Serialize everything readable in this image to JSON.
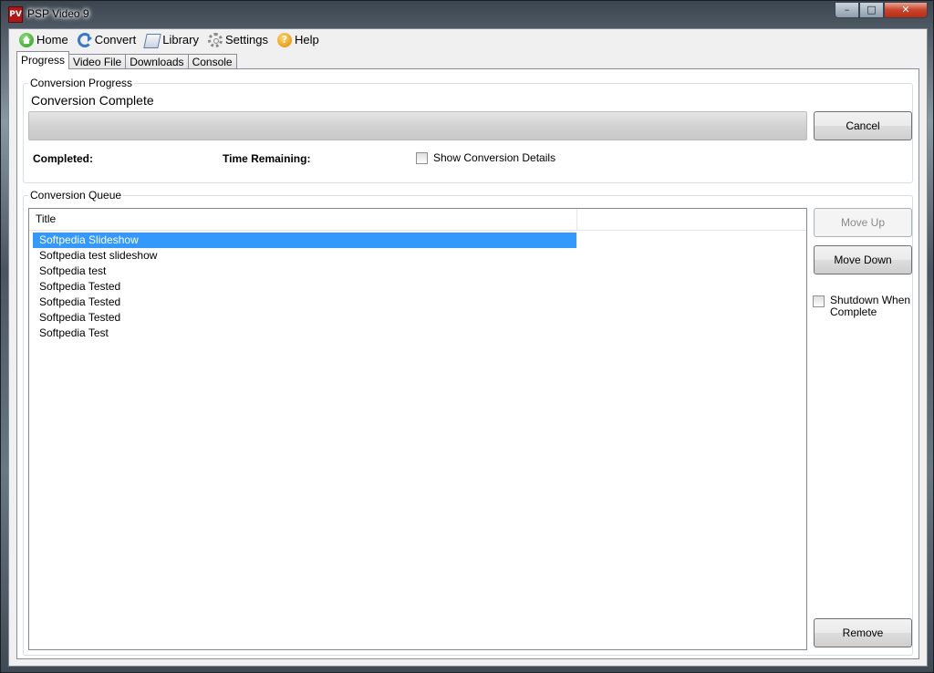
{
  "window": {
    "title": "PSP Video 9",
    "icon": "app-icon",
    "app_icon_glyph": "PV",
    "buttons": {
      "minimize": "–",
      "maximize": "□",
      "close": "✕"
    }
  },
  "menu": [
    {
      "label": "Home",
      "icon": "home-icon"
    },
    {
      "label": "Convert",
      "icon": "convert-icon"
    },
    {
      "label": "Library",
      "icon": "library-icon"
    },
    {
      "label": "Settings",
      "icon": "settings-icon"
    },
    {
      "label": "Help",
      "icon": "help-icon",
      "glyph": "?"
    }
  ],
  "tabs": [
    {
      "label": "Progress",
      "active": true
    },
    {
      "label": "Video File"
    },
    {
      "label": "Downloads"
    },
    {
      "label": "Console"
    }
  ],
  "progress_group": {
    "legend": "Conversion Progress",
    "status": "Conversion Complete",
    "progress": 0,
    "cancel_label": "Cancel",
    "completed_label": "Completed:",
    "time_remaining_label": "Time Remaining:",
    "show_details_label": "Show Conversion Details",
    "show_details_checked": false
  },
  "queue_group": {
    "legend": "Conversion Queue",
    "column_title": "Title",
    "rows": [
      {
        "title": "Softpedia Slideshow",
        "selected": true
      },
      {
        "title": "Softpedia test slideshow"
      },
      {
        "title": "Softpedia test"
      },
      {
        "title": "Softpedia Tested"
      },
      {
        "title": "Softpedia Tested"
      },
      {
        "title": "Softpedia Tested"
      },
      {
        "title": "Softpedia Test"
      }
    ],
    "move_up_label": "Move Up",
    "move_up_enabled": false,
    "move_down_label": "Move Down",
    "shutdown_label": "Shutdown When Complete",
    "shutdown_checked": false,
    "remove_label": "Remove"
  }
}
